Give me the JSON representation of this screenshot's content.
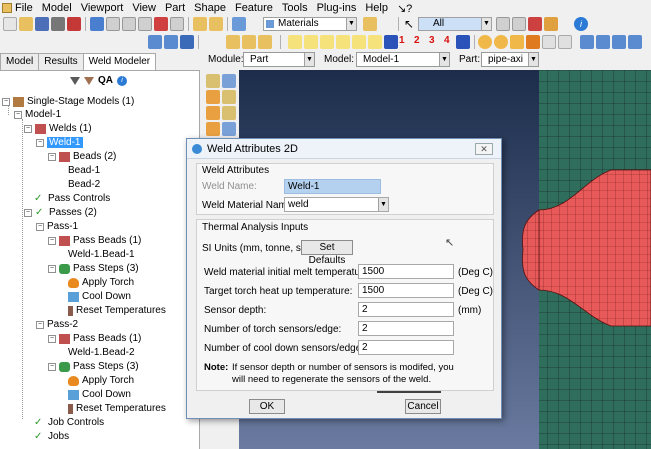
{
  "menu": {
    "items": [
      "File",
      "Model",
      "Viewport",
      "View",
      "Part",
      "Shape",
      "Feature",
      "Tools",
      "Plug-ins",
      "Help",
      "↘?"
    ]
  },
  "toolbar": {
    "materials_combo": "Materials",
    "select_combo": "All",
    "numbers": [
      "1",
      "2",
      "3",
      "4"
    ]
  },
  "left_tabs": [
    "Model",
    "Results",
    "Weld Modeler"
  ],
  "qa_label": "QA",
  "tree": {
    "root": "Single-Stage Models (1)",
    "model": "Model-1",
    "welds": "Welds (1)",
    "weld1": "Weld-1",
    "beads": "Beads (2)",
    "bead1": "Bead-1",
    "bead2": "Bead-2",
    "pass_controls": "Pass Controls",
    "passes": "Passes (2)",
    "pass1": "Pass-1",
    "pass1_beads": "Pass Beads (1)",
    "pass1_bead": "Weld-1.Bead-1",
    "pass1_steps": "Pass Steps (3)",
    "apply_torch": "Apply Torch",
    "cool_down": "Cool Down",
    "reset_temps": "Reset Temperatures",
    "pass2": "Pass-2",
    "pass2_beads": "Pass Beads (1)",
    "pass2_bead": "Weld-1.Bead-2",
    "pass2_steps": "Pass Steps (3)",
    "apply_torch2": "Apply Torch",
    "cool_down2": "Cool Down",
    "reset_temps2": "Reset Temperatures",
    "job_controls": "Job Controls",
    "jobs": "Jobs"
  },
  "context": {
    "module_label": "Module:",
    "module_value": "Part",
    "model_label": "Model:",
    "model_value": "Model-1",
    "part_label": "Part:",
    "part_value": "pipe-axi"
  },
  "dialog": {
    "title": "Weld Attributes 2D",
    "weld_attributes_label": "Weld Attributes",
    "weld_name_label": "Weld Name:",
    "weld_name_value": "Weld-1",
    "weld_material_label": "Weld Material Name:",
    "weld_material_value": "weld",
    "thermal_label": "Thermal Analysis Inputs",
    "si_units_label": "SI Units (mm, tonne, sec)",
    "set_defaults_label": "Set Defaults",
    "melt_temp_label": "Weld material initial melt temperature:",
    "melt_temp_value": "1500",
    "melt_temp_unit": "(Deg C)",
    "torch_temp_label": "Target torch heat up temperature:",
    "torch_temp_value": "1500",
    "torch_temp_unit": "(Deg C)",
    "sensor_depth_label": "Sensor depth:",
    "sensor_depth_value": "2",
    "sensor_depth_unit": "(mm)",
    "torch_sensors_label": "Number of torch sensors/edge:",
    "torch_sensors_value": "2",
    "cool_sensors_label": "Number of cool down sensors/edge:",
    "cool_sensors_value": "2",
    "note_label": "Note:",
    "note_line1": "If sensor depth or number of sensors is modifed, you",
    "note_line2": "will need to regenerate the sensors of the weld.",
    "ok_label": "OK",
    "cancel_label": "Cancel"
  },
  "colors": {
    "plate": "#2f6e5c",
    "weld": "#e85a5a",
    "mesh_line": "#1b2f28",
    "selection": "#3399ff"
  }
}
